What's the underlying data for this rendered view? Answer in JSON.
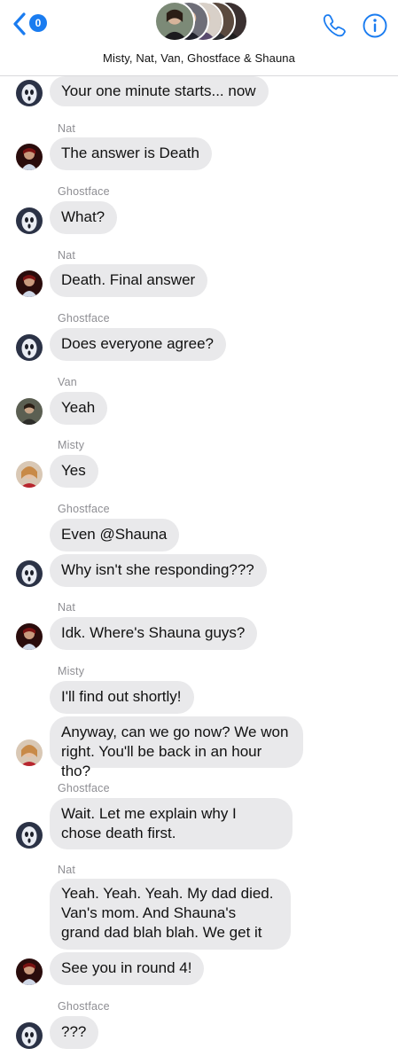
{
  "header": {
    "unread_count": "0",
    "group_name": "Misty, Nat, Van, Ghostface & Shauna"
  },
  "messages": [
    {
      "sender": "",
      "text": "Your one minute starts... now",
      "avatar": "ghostface"
    },
    {
      "sender": "Nat",
      "text": "The answer is Death",
      "avatar": "nat"
    },
    {
      "sender": "Ghostface",
      "text": "What?",
      "avatar": "ghostface"
    },
    {
      "sender": "Nat",
      "text": "Death. Final answer",
      "avatar": "nat"
    },
    {
      "sender": "Ghostface",
      "text": "Does everyone agree?",
      "avatar": "ghostface"
    },
    {
      "sender": "Van",
      "text": "Yeah",
      "avatar": "van"
    },
    {
      "sender": "Misty",
      "text": "Yes",
      "avatar": "misty"
    },
    {
      "sender": "Ghostface",
      "text": "Even @Shauna",
      "avatar": ""
    },
    {
      "sender": "",
      "text": "Why isn't she responding???",
      "avatar": "ghostface"
    },
    {
      "sender": "Nat",
      "text": "Idk. Where's Shauna guys?",
      "avatar": "nat"
    },
    {
      "sender": "Misty",
      "text": "I'll find out shortly!",
      "avatar": ""
    },
    {
      "sender": "",
      "text": "Anyway, can we go now? We won right. You'll be back in an hour tho?",
      "avatar": "misty"
    },
    {
      "sender": "Ghostface",
      "text": "Wait. Let me explain why I chose death first.",
      "avatar": "ghostface"
    },
    {
      "sender": "Nat",
      "text": "Yeah. Yeah. Yeah. My dad died. Van's mom. And Shauna's grand dad blah blah. We get it",
      "avatar": ""
    },
    {
      "sender": "",
      "text": "See you in round 4!",
      "avatar": "nat"
    },
    {
      "sender": "Ghostface",
      "text": "???",
      "avatar": "ghostface"
    }
  ],
  "colors": {
    "accent": "#1a7cf0",
    "bubble": "#e9e9eb",
    "sender_label": "#8e8e93"
  },
  "icons": {
    "back": "chevron-left-icon",
    "call": "phone-icon",
    "info": "info-icon"
  }
}
